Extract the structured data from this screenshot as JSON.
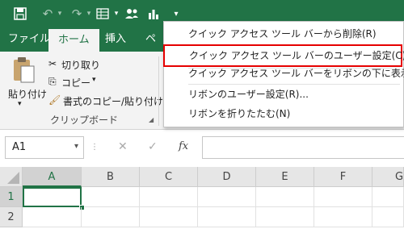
{
  "qat": {
    "icons": [
      "save-icon",
      "undo-icon",
      "redo-icon",
      "form-icon",
      "people-icon",
      "chart-icon",
      "qat-dropdown-icon"
    ]
  },
  "tabs": {
    "file": "ファイル",
    "home": "ホーム",
    "insert": "挿入",
    "page_partial": "ペ"
  },
  "ribbon": {
    "paste": "貼り付け",
    "cut": "切り取り",
    "copy": "コピー",
    "format_painter": "書式のコピー/貼り付け",
    "group_clipboard": "クリップボード"
  },
  "formula_bar": {
    "name_box": "A1",
    "fx": "fx"
  },
  "sheet": {
    "columns": [
      "A",
      "B",
      "C",
      "D",
      "E",
      "F",
      "G"
    ],
    "rows": [
      "1",
      "2"
    ],
    "active_cell": "A1"
  },
  "menu": {
    "items": [
      "クイック アクセス ツール バーから削除(R)",
      "クイック アクセス ツール バーのユーザー設定(C)...",
      "クイック アクセス ツール バーをリボンの下に表示(S)",
      "リボンのユーザー設定(R)...",
      "リボンを折りたたむ(N)"
    ],
    "highlighted_index": 1,
    "highlight_color": "#e60000"
  },
  "colors": {
    "excel_green": "#217346",
    "ribbon_bg": "#f3f3f3"
  }
}
